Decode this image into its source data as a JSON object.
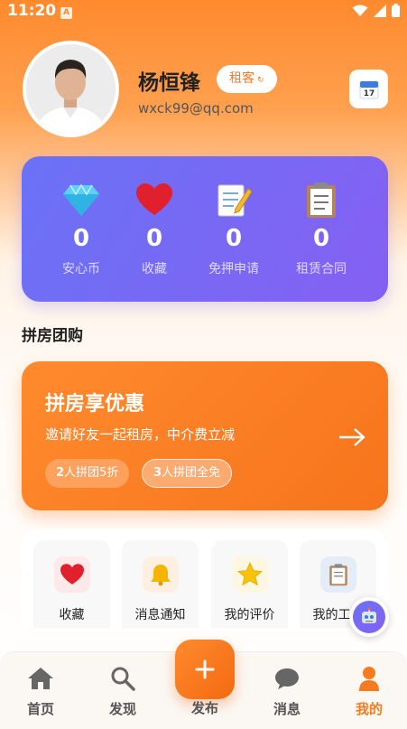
{
  "status_bar": {
    "time": "11:20",
    "notification_icon": "A"
  },
  "profile": {
    "name": "杨恒锋",
    "role_badge": "租客",
    "email": "wxck99@qq.com",
    "calendar_icon": "calendar-icon"
  },
  "stats": [
    {
      "icon": "diamond-icon",
      "value": "0",
      "label": "安心币"
    },
    {
      "icon": "heart-icon",
      "value": "0",
      "label": "收藏"
    },
    {
      "icon": "memo-icon",
      "value": "0",
      "label": "免押申请"
    },
    {
      "icon": "clipboard-icon",
      "value": "0",
      "label": "租赁合同"
    }
  ],
  "group_section": {
    "title": "拼房团购"
  },
  "promo": {
    "title": "拼房享优惠",
    "description": "邀请好友一起租房，中介费立减",
    "tags": [
      {
        "num": "2",
        "text": "人拼团5折"
      },
      {
        "num": "3",
        "text": "人拼团全免"
      }
    ]
  },
  "quick_actions": [
    {
      "icon": "heart-icon",
      "label": "收藏",
      "bg": "#fde9e9"
    },
    {
      "icon": "bell-icon",
      "label": "消息通知",
      "bg": "#fdf0e1"
    },
    {
      "icon": "star-icon",
      "label": "我的评价",
      "bg": "#fdf6e0"
    },
    {
      "icon": "clipboard-icon",
      "label": "我的工单",
      "bg": "#e4ecf8"
    }
  ],
  "tab_bar": {
    "items": [
      {
        "label": "首页",
        "icon": "home-icon"
      },
      {
        "label": "发现",
        "icon": "search-icon"
      },
      {
        "label": "发布",
        "icon": "plus-icon"
      },
      {
        "label": "消息",
        "icon": "chat-icon"
      },
      {
        "label": "我的",
        "icon": "person-icon"
      }
    ],
    "active_index": 4
  },
  "colors": {
    "accent": "#f47b20",
    "stats_gradient_start": "#6a72f6",
    "stats_gradient_end": "#8560f2"
  }
}
